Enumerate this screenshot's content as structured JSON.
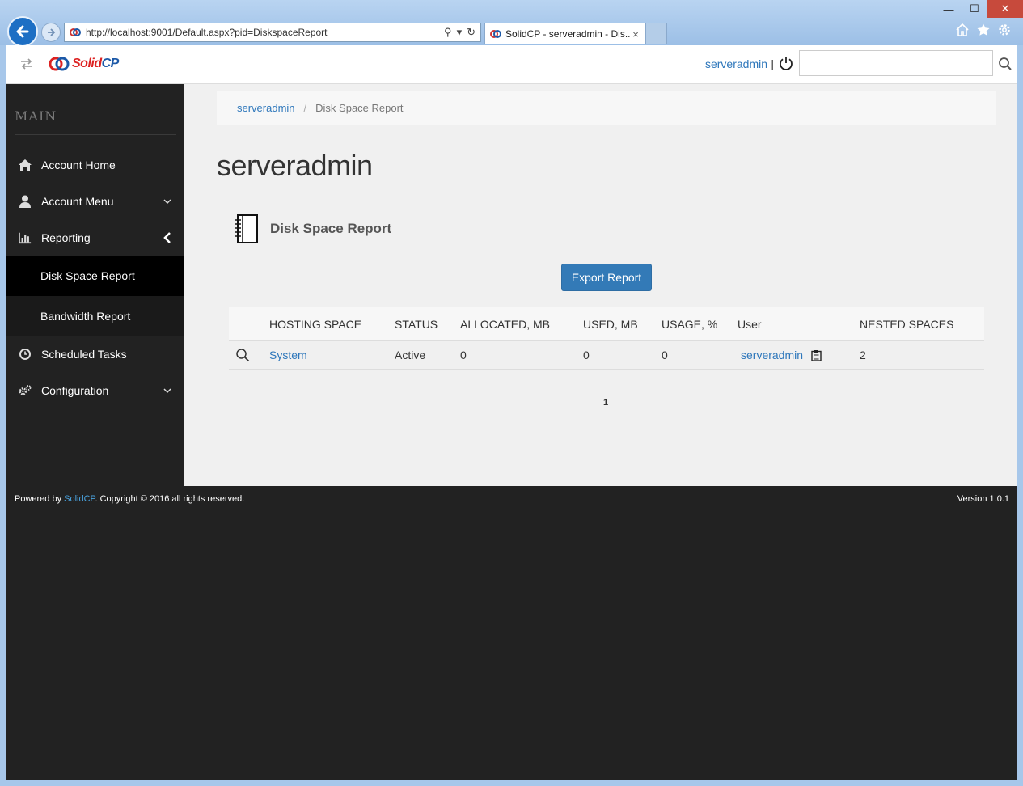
{
  "browser": {
    "url": "http://localhost:9001/Default.aspx?pid=DiskspaceReport",
    "tab_title": "SolidCP - serveradmin - Dis...",
    "tab_close": "×",
    "min_label": "—",
    "max_label": "☐",
    "close_label": "✕"
  },
  "topbar": {
    "logo_solid": "Solid",
    "logo_cp": "CP",
    "user": "serveradmin",
    "separator": "|",
    "search_placeholder": ""
  },
  "sidebar": {
    "heading": "MAIN",
    "items": [
      {
        "label": "Account Home",
        "icon": "home-icon"
      },
      {
        "label": "Account Menu",
        "icon": "user-icon",
        "chevron": "down"
      },
      {
        "label": "Reporting",
        "icon": "bar-chart-icon",
        "chevron": "left"
      },
      {
        "label": "Scheduled Tasks",
        "icon": "clock-icon"
      },
      {
        "label": "Configuration",
        "icon": "gears-icon",
        "chevron": "down"
      }
    ],
    "subitems": [
      {
        "label": "Disk Space Report",
        "active": true
      },
      {
        "label": "Bandwidth Report",
        "active": false
      }
    ]
  },
  "content": {
    "breadcrumb": {
      "link": "serveradmin",
      "separator": "/",
      "current": "Disk Space Report"
    },
    "page_title": "serveradmin",
    "report_title": "Disk Space Report",
    "export_label": "Export Report",
    "grid": {
      "columns": [
        "HOSTING SPACE",
        "STATUS",
        "ALLOCATED, MB",
        "USED, MB",
        "USAGE, %",
        "User",
        "NESTED SPACES"
      ],
      "rows": [
        {
          "space": "System",
          "status": "Active",
          "allocated": "0",
          "used": "0",
          "usage": "0",
          "user": "serveradmin",
          "nested": "2"
        }
      ]
    },
    "pager": "1"
  },
  "footer": {
    "powered_by": "Powered by ",
    "brand": "SolidCP",
    "copyright": ". Copyright © 2016 all rights reserved.",
    "version": "Version 1.0.1"
  },
  "colors": {
    "accent": "#337ab7",
    "link": "#2e77bb",
    "sidebar_bg": "#222222",
    "active_item_bg": "#000000",
    "content_bg": "#f0f0f0"
  }
}
